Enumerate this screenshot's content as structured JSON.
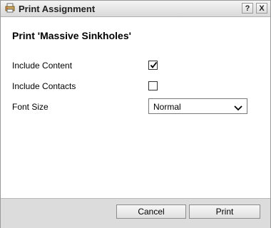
{
  "window": {
    "title": "Print Assignment",
    "help_label": "?",
    "close_label": "X"
  },
  "heading": "Print 'Massive Sinkholes'",
  "options": {
    "include_content": {
      "label": "Include Content",
      "checked": true
    },
    "include_contacts": {
      "label": "Include Contacts",
      "checked": false
    },
    "font_size": {
      "label": "Font Size",
      "value": "Normal"
    }
  },
  "footer": {
    "cancel_label": "Cancel",
    "print_label": "Print"
  }
}
